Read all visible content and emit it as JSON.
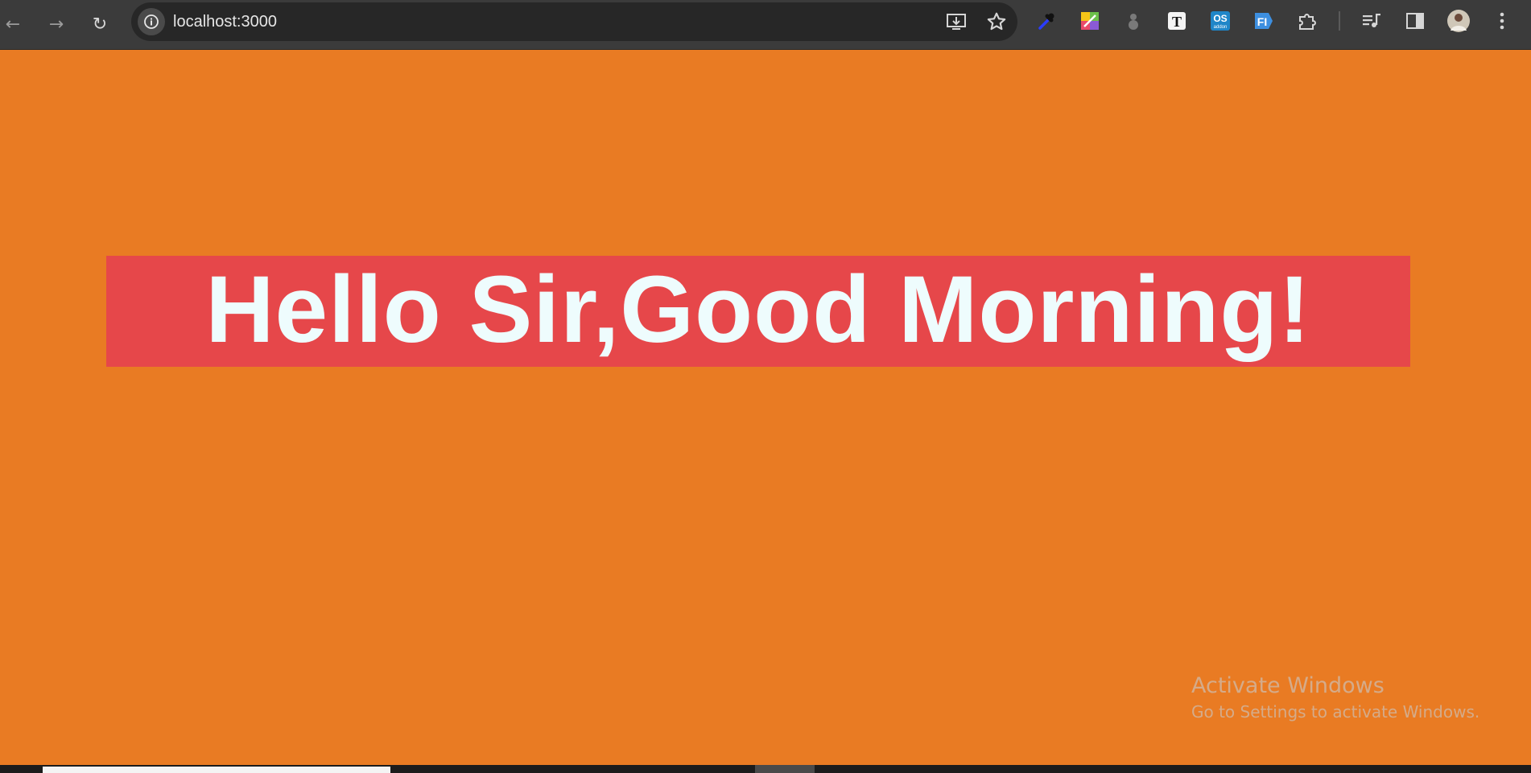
{
  "browser": {
    "url": "localhost:3000",
    "nav": {
      "back": "←",
      "forward": "→",
      "reload": "↻"
    }
  },
  "extensions": [
    {
      "name": "eyedropper-icon"
    },
    {
      "name": "color-grid-extension-icon"
    },
    {
      "name": "grey-figure-extension-icon"
    },
    {
      "name": "text-t-extension-icon",
      "label": "T"
    },
    {
      "name": "os-addon-extension-icon",
      "label": "OS",
      "sublabel": "addon"
    },
    {
      "name": "fi-extension-icon",
      "label": "FI"
    },
    {
      "name": "puzzle-icon"
    },
    {
      "name": "media-queue-icon"
    },
    {
      "name": "side-panel-icon"
    },
    {
      "name": "profile-avatar"
    },
    {
      "name": "more-menu-icon"
    }
  ],
  "page": {
    "greeting": "Hello Sir,Good Morning!"
  },
  "watermark": {
    "title": "Activate Windows",
    "subtitle": "Go to Settings to activate Windows."
  },
  "colors": {
    "background": "#e97b23",
    "banner": "#e6474a",
    "text": "#eefcfd",
    "chrome": "#3b3b3b"
  }
}
